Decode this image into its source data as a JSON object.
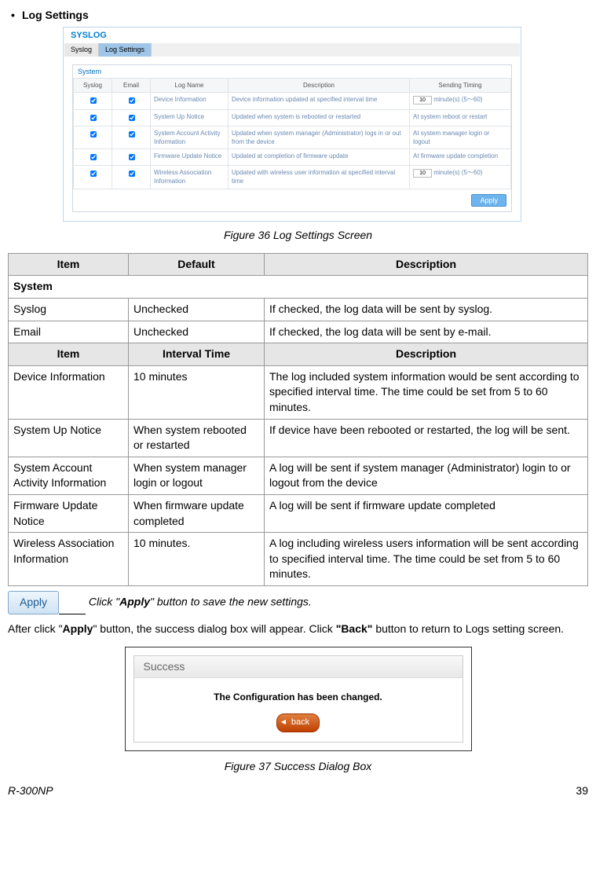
{
  "heading": "Log Settings",
  "panel": {
    "title": "SYSLOG",
    "tabs": [
      "Syslog",
      "Log Settings"
    ],
    "section": "System",
    "headers": [
      "Syslog",
      "Email",
      "Log Name",
      "Description",
      "Sending Timing"
    ],
    "rows": [
      {
        "name": "Device Information",
        "desc": "Device information updated at specified interval time",
        "timing_prefix": "",
        "minutes": "10",
        "timing_suffix": " minute(s)  (5～60)"
      },
      {
        "name": "System Up Notice",
        "desc": "Updated when system is rebooted or restarted",
        "timing": "At system reboot or restart"
      },
      {
        "name": "System Account Activity Information",
        "desc": "Updated when system manager (Administrator) logs in or out from the device",
        "timing": "At system manager login or logout"
      },
      {
        "name": "Firmware Update Notice",
        "desc": "Updated at completion of firmware update",
        "timing": "At firmware update completion"
      },
      {
        "name": "Wireless Association Information",
        "desc": "Updated with wireless user information at specified interval time",
        "timing_prefix": "",
        "minutes": "10",
        "timing_suffix": " minute(s)  (5～60)"
      }
    ],
    "apply": "Apply"
  },
  "fig36": "Figure 36 Log Settings Screen",
  "doc_headers1": {
    "item": "Item",
    "default": "Default",
    "desc": "Description"
  },
  "system_label": "System",
  "sys_rows": [
    {
      "item": "Syslog",
      "def": "Unchecked",
      "desc": "If checked, the log data will be sent by syslog."
    },
    {
      "item": "Email",
      "def": "Unchecked",
      "desc": "If checked, the log data will be sent by e-mail."
    }
  ],
  "doc_headers2": {
    "item": "Item",
    "interval": "Interval Time",
    "desc": "Description"
  },
  "int_rows": [
    {
      "item": "Device Information",
      "int": "10 minutes",
      "desc": "The log included system information would be sent according to specified interval time. The time could be set from 5 to 60 minutes."
    },
    {
      "item": "System Up Notice",
      "int": "When system rebooted or restarted",
      "desc": "If device have been rebooted or restarted, the log will be sent."
    },
    {
      "item": "System Account Activity Information",
      "int": "When system manager login or logout",
      "desc": "A log will be sent if system manager (Administrator) login to or logout from the device"
    },
    {
      "item": "Firmware Update Notice",
      "int": "When firmware update completed",
      "desc": "A log will be sent if firmware update completed"
    },
    {
      "item": "Wireless Association Information",
      "int": "10 minutes.",
      "desc": "A log including wireless users information will be sent according to specified interval time. The time could be set from 5 to 60 minutes."
    }
  ],
  "apply_big": "Apply",
  "apply_note_pre": "Click \"",
  "apply_note_bold": "Apply",
  "apply_note_post": "\" button to save the new settings.",
  "after_pre": "After click \"",
  "after_bold1": "Apply",
  "after_mid": "\" button, the success dialog box will appear. Click ",
  "after_bold2": "\"Back\"",
  "after_post": " button to return to Logs setting screen.",
  "success_title": "Success",
  "success_msg": "The Configuration has been changed.",
  "back": "back",
  "fig37": "Figure 37 Success Dialog Box",
  "footer_model": "R-300NP",
  "footer_page": "39"
}
